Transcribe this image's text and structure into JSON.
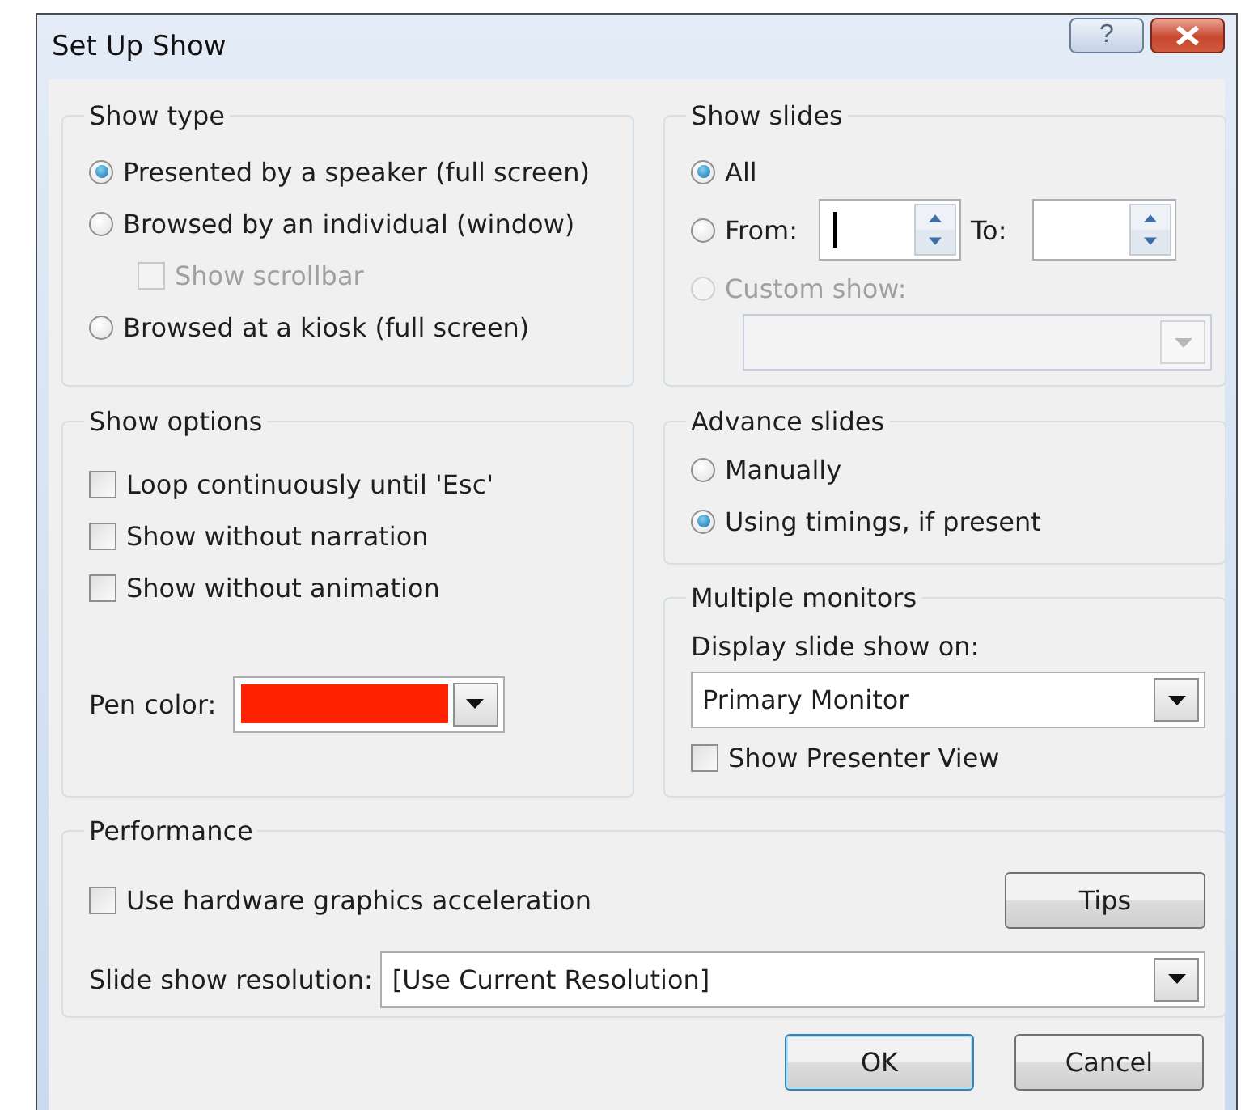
{
  "window": {
    "title": "Set Up Show",
    "help_button": "?"
  },
  "show_type": {
    "title": "Show type",
    "options": [
      {
        "kind": "radio",
        "label": "Presented by a speaker (full screen)",
        "selected": true,
        "disabled": false
      },
      {
        "kind": "radio",
        "label": "Browsed by an individual (window)",
        "selected": false,
        "disabled": false
      },
      {
        "kind": "checkbox",
        "label": "Show scrollbar",
        "checked": false,
        "disabled": true
      },
      {
        "kind": "radio",
        "label": "Browsed at a kiosk (full screen)",
        "selected": false,
        "disabled": false
      }
    ]
  },
  "show_slides": {
    "title": "Show slides",
    "all": {
      "label": "All",
      "selected": true
    },
    "from": {
      "label": "From:",
      "selected": false,
      "focused": true
    },
    "to": {
      "label": "To:"
    },
    "custom_show": {
      "label": "Custom show:",
      "selected": false,
      "disabled": true
    }
  },
  "show_options": {
    "title": "Show options",
    "checkboxes": [
      {
        "label": "Loop continuously until 'Esc'",
        "checked": false
      },
      {
        "label": "Show without narration",
        "checked": false
      },
      {
        "label": "Show without animation",
        "checked": false
      }
    ],
    "pen_color": {
      "label": "Pen color:",
      "color": "#ff2200"
    }
  },
  "advance_slides": {
    "title": "Advance slides",
    "options": [
      {
        "label": "Manually",
        "selected": false
      },
      {
        "label": "Using timings, if present",
        "selected": true
      }
    ]
  },
  "multiple_monitors": {
    "title": "Multiple monitors",
    "display_label": "Display slide show on:",
    "display_value": "Primary Monitor",
    "presenter_view": {
      "label": "Show Presenter View",
      "checked": false
    }
  },
  "performance": {
    "title": "Performance",
    "hardware_acceleration": {
      "label": "Use hardware graphics acceleration",
      "checked": false
    },
    "tips_button": "Tips",
    "resolution_label": "Slide show resolution:",
    "resolution_value": "[Use Current Resolution]"
  },
  "buttons": [
    {
      "label": "OK",
      "default": true
    },
    {
      "label": "Cancel",
      "default": false
    }
  ]
}
